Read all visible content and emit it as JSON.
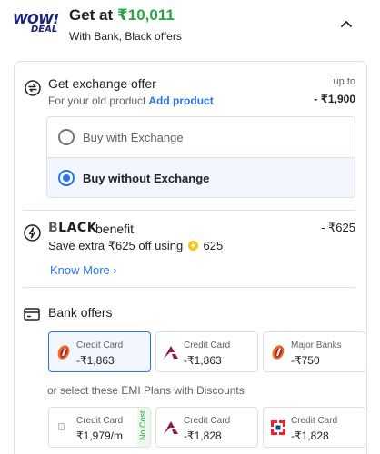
{
  "header": {
    "logo_top": "WOW!",
    "logo_bottom": "DEAL",
    "get_at_prefix": "Get at",
    "get_at_price": "₹10,011",
    "subtitle": "With Bank, Black offers"
  },
  "exchange": {
    "title": "Get exchange offer",
    "subtitle": "For your old product",
    "add_product": "Add product",
    "upto_label": "up to",
    "upto_value": "- ₹1,900",
    "options": [
      {
        "label": "Buy with Exchange",
        "selected": false
      },
      {
        "label": "Buy without Exchange",
        "selected": true
      }
    ]
  },
  "black": {
    "brand_first": "B",
    "brand_rest": "LACK",
    "benefit": "benefit",
    "value": "- ₹625",
    "save_text": "Save extra ₹625 off using",
    "coins": "625",
    "know_more": "Know More ›"
  },
  "bank_offers": {
    "title": "Bank offers",
    "offers": [
      {
        "type": "Credit Card",
        "value": "-₹1,863",
        "selected": true
      },
      {
        "type": "Credit Card",
        "value": "-₹1,863",
        "selected": false
      },
      {
        "type": "Major Banks",
        "value": "-₹750",
        "selected": false
      }
    ],
    "emi_text": "or select these EMI Plans with Discounts",
    "emi": [
      {
        "type": "Credit Card",
        "value": "₹1,979/m",
        "badge": "No Cost"
      },
      {
        "type": "Credit Card",
        "value": "-₹1,828"
      },
      {
        "type": "Credit Card",
        "value": "-₹1,828"
      }
    ]
  },
  "colors": {
    "price_green": "#26a541",
    "link_blue": "#2874f0",
    "selected_bg": "#f1f6ff",
    "logo_navy": "#1a237e"
  }
}
